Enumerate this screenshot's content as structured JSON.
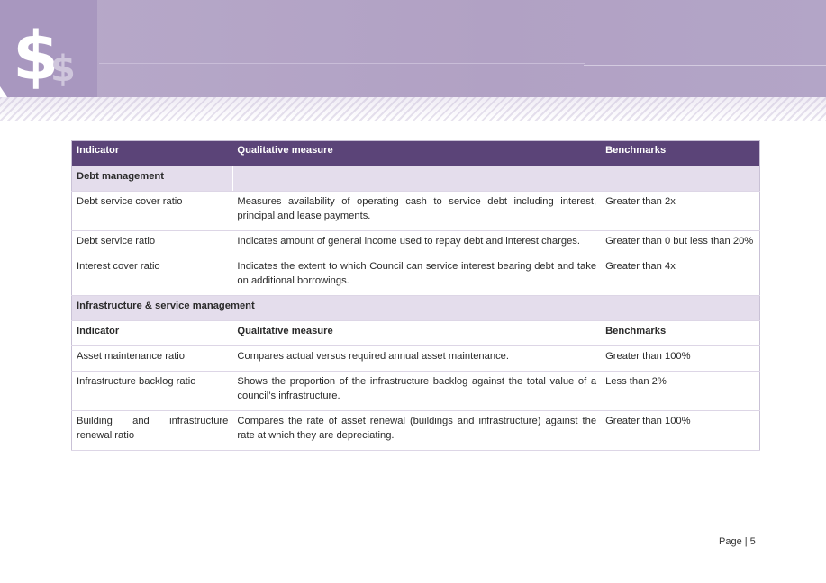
{
  "header": {
    "logo_icon": "dollar-sign-icon"
  },
  "colors": {
    "banner": "#b3a5c7",
    "table_header": "#5b4478",
    "section_band": "#e4ddec"
  },
  "table": {
    "headers": [
      "Indicator",
      "Qualitative measure",
      "Benchmarks"
    ],
    "section1": "Debt management",
    "rows1": [
      {
        "indicator": "Debt service cover ratio",
        "measure": "Measures availability of operating cash to service debt including interest, principal and lease payments.",
        "benchmark": "Greater than 2x"
      },
      {
        "indicator": "Debt service ratio",
        "measure": "Indicates amount of general income used to repay debt and interest charges.",
        "benchmark": "Greater than 0 but less than 20%"
      },
      {
        "indicator": "Interest cover ratio",
        "measure": "Indicates the extent to which Council can service interest bearing debt and take on additional borrowings.",
        "benchmark": "Greater than 4x"
      }
    ],
    "section2": "Infrastructure & service management",
    "subheaders": [
      "Indicator",
      "Qualitative measure",
      "Benchmarks"
    ],
    "rows2": [
      {
        "indicator": "Asset maintenance ratio",
        "measure": "Compares actual versus required annual asset maintenance.",
        "benchmark": "Greater than 100%"
      },
      {
        "indicator": "Infrastructure backlog ratio",
        "measure": "Shows the proportion of the infrastructure backlog against the total value of a council’s infrastructure.",
        "benchmark": "Less than 2%"
      },
      {
        "indicator": "Building and infrastructure renewal ratio",
        "measure": "Compares the rate of asset renewal (buildings and infrastructure) against the rate at which they are depreciating.",
        "benchmark": "Greater than 100%"
      }
    ]
  },
  "footer": {
    "page": "Page | 5"
  }
}
